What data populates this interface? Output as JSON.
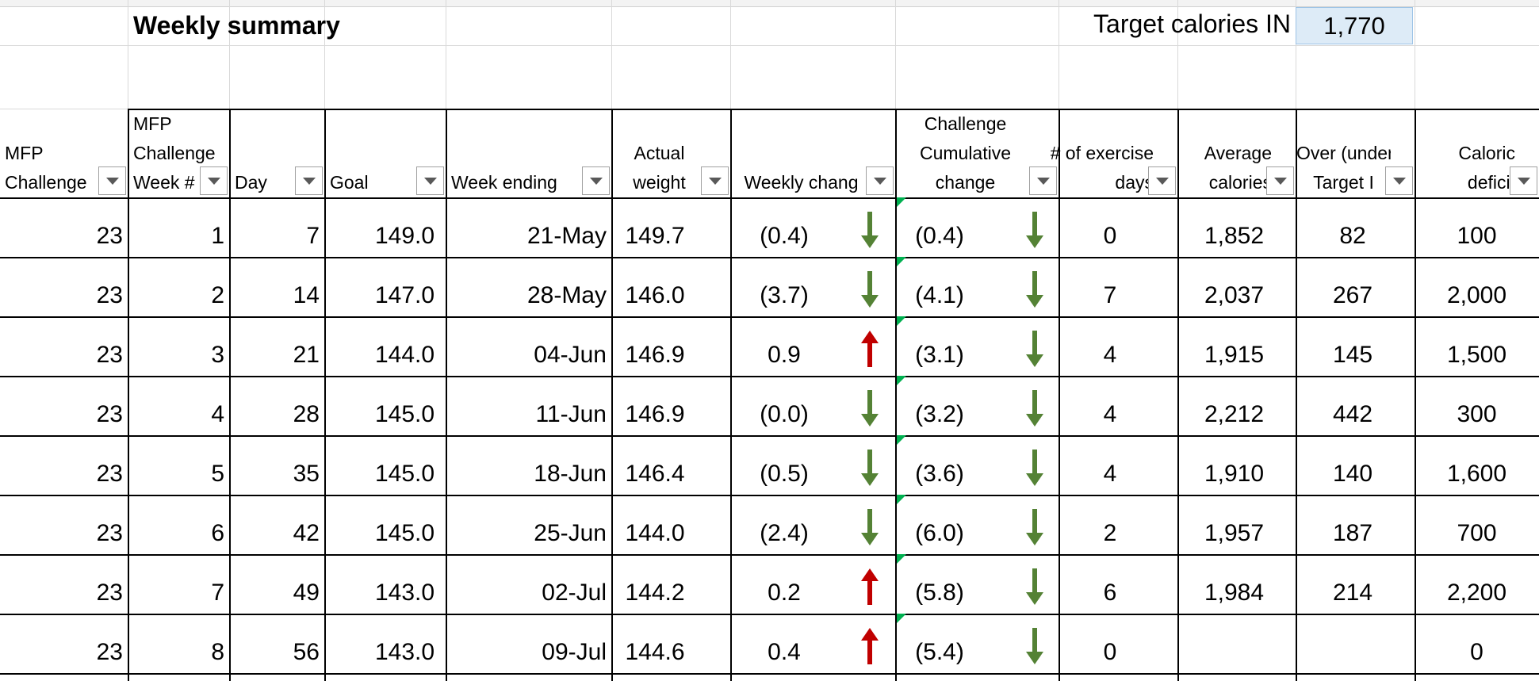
{
  "sheet": {
    "title": "Weekly summary",
    "target_label": "Target calories IN",
    "target_value": "1,770"
  },
  "headers": [
    {
      "lines": [
        "MFP",
        "Challenge"
      ]
    },
    {
      "lines": [
        "MFP",
        "Challenge",
        "Week #"
      ]
    },
    {
      "lines": [
        "Day"
      ]
    },
    {
      "lines": [
        "Goal"
      ]
    },
    {
      "lines": [
        "Week ending"
      ]
    },
    {
      "lines": [
        "Actual",
        "weight"
      ]
    },
    {
      "lines": [
        "Weekly chang"
      ]
    },
    {
      "lines": [
        "Challenge",
        "Cumulative",
        "change"
      ]
    },
    {
      "lines": [
        "# of exercise",
        "days"
      ]
    },
    {
      "lines": [
        "Average",
        "calories"
      ]
    },
    {
      "lines": [
        "Over (under)",
        "Target I"
      ]
    },
    {
      "lines": [
        "Caloric",
        "deficit"
      ]
    }
  ],
  "rows": [
    {
      "challenge": "23",
      "week": "1",
      "day": "7",
      "goal": "149.0",
      "week_ending": "21-May",
      "actual": "149.7",
      "weekly": "(0.4)",
      "weekly_dir": "down",
      "cumulative": "(0.4)",
      "cumulative_dir": "down",
      "exercise": "0",
      "avg_cal": "1,852",
      "over": "82",
      "deficit": "100"
    },
    {
      "challenge": "23",
      "week": "2",
      "day": "14",
      "goal": "147.0",
      "week_ending": "28-May",
      "actual": "146.0",
      "weekly": "(3.7)",
      "weekly_dir": "down",
      "cumulative": "(4.1)",
      "cumulative_dir": "down",
      "exercise": "7",
      "avg_cal": "2,037",
      "over": "267",
      "deficit": "2,000"
    },
    {
      "challenge": "23",
      "week": "3",
      "day": "21",
      "goal": "144.0",
      "week_ending": "04-Jun",
      "actual": "146.9",
      "weekly": "0.9",
      "weekly_dir": "up",
      "cumulative": "(3.1)",
      "cumulative_dir": "down",
      "exercise": "4",
      "avg_cal": "1,915",
      "over": "145",
      "deficit": "1,500"
    },
    {
      "challenge": "23",
      "week": "4",
      "day": "28",
      "goal": "145.0",
      "week_ending": "11-Jun",
      "actual": "146.9",
      "weekly": "(0.0)",
      "weekly_dir": "down",
      "cumulative": "(3.2)",
      "cumulative_dir": "down",
      "exercise": "4",
      "avg_cal": "2,212",
      "over": "442",
      "deficit": "300"
    },
    {
      "challenge": "23",
      "week": "5",
      "day": "35",
      "goal": "145.0",
      "week_ending": "18-Jun",
      "actual": "146.4",
      "weekly": "(0.5)",
      "weekly_dir": "down",
      "cumulative": "(3.6)",
      "cumulative_dir": "down",
      "exercise": "4",
      "avg_cal": "1,910",
      "over": "140",
      "deficit": "1,600"
    },
    {
      "challenge": "23",
      "week": "6",
      "day": "42",
      "goal": "145.0",
      "week_ending": "25-Jun",
      "actual": "144.0",
      "weekly": "(2.4)",
      "weekly_dir": "down",
      "cumulative": "(6.0)",
      "cumulative_dir": "down",
      "exercise": "2",
      "avg_cal": "1,957",
      "over": "187",
      "deficit": "700"
    },
    {
      "challenge": "23",
      "week": "7",
      "day": "49",
      "goal": "143.0",
      "week_ending": "02-Jul",
      "actual": "144.2",
      "weekly": "0.2",
      "weekly_dir": "up",
      "cumulative": "(5.8)",
      "cumulative_dir": "down",
      "exercise": "6",
      "avg_cal": "1,984",
      "over": "214",
      "deficit": "2,200"
    },
    {
      "challenge": "23",
      "week": "8",
      "day": "56",
      "goal": "143.0",
      "week_ending": "09-Jul",
      "actual": "144.6",
      "weekly": "0.4",
      "weekly_dir": "up",
      "cumulative": "(5.4)",
      "cumulative_dir": "down",
      "exercise": "0",
      "avg_cal": "",
      "over": "",
      "deficit": "0"
    }
  ],
  "colors": {
    "up_arrow": "#c00000",
    "down_arrow": "#548235",
    "target_fill": "#ddebf7",
    "comment_marker": "#00b050"
  }
}
